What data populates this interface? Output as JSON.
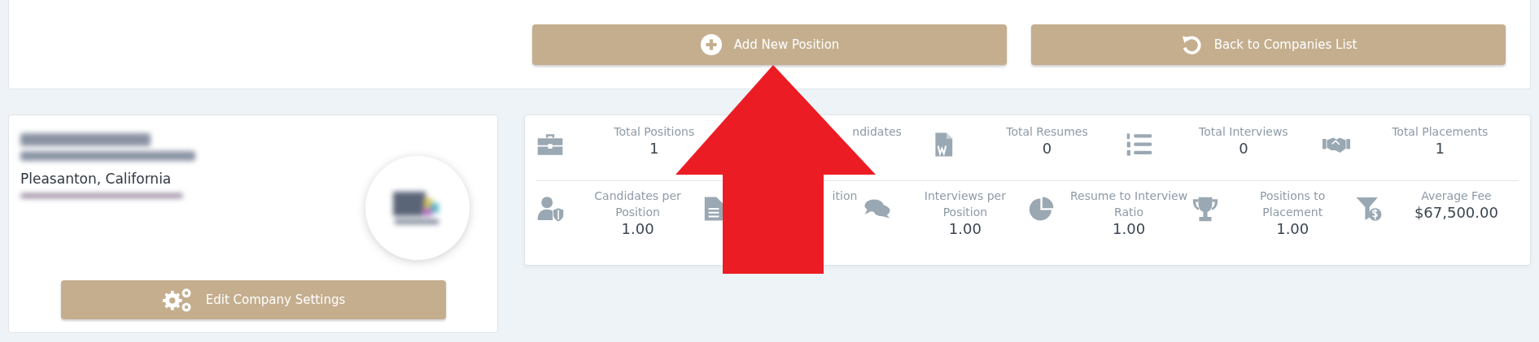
{
  "toolbar": {
    "buttons": [
      {
        "label": "Add New Position"
      },
      {
        "label": "Back to Companies List"
      }
    ]
  },
  "company": {
    "city": "Pleasanton, California",
    "button": {
      "label": "Edit Company Settings"
    }
  },
  "stats": {
    "totals": [
      {
        "label": "Total Positions",
        "value": "1",
        "covered": false
      },
      {
        "label": "ndidates",
        "covered": true
      },
      {
        "label": "Total Resumes",
        "value": "0",
        "covered": false
      },
      {
        "label": "Total Interviews",
        "value": "0",
        "covered": false
      },
      {
        "label": "Total Placements",
        "value": "1",
        "covered": false
      }
    ],
    "ratios": [
      {
        "label": "Candidates per Position",
        "value": "1.00",
        "covered": false
      },
      {
        "label": "ition",
        "covered": true
      },
      {
        "label": "Interviews per Position",
        "value": "1.00",
        "covered": false
      },
      {
        "label": "Resume to Interview Ratio",
        "value": "1.00",
        "covered": false
      },
      {
        "label": "Positions to Placement",
        "value": "1.00",
        "covered": false
      },
      {
        "label": "Average Fee",
        "value": "$67,500.00",
        "covered": false
      }
    ]
  },
  "annotation": {
    "kind": "arrow"
  }
}
